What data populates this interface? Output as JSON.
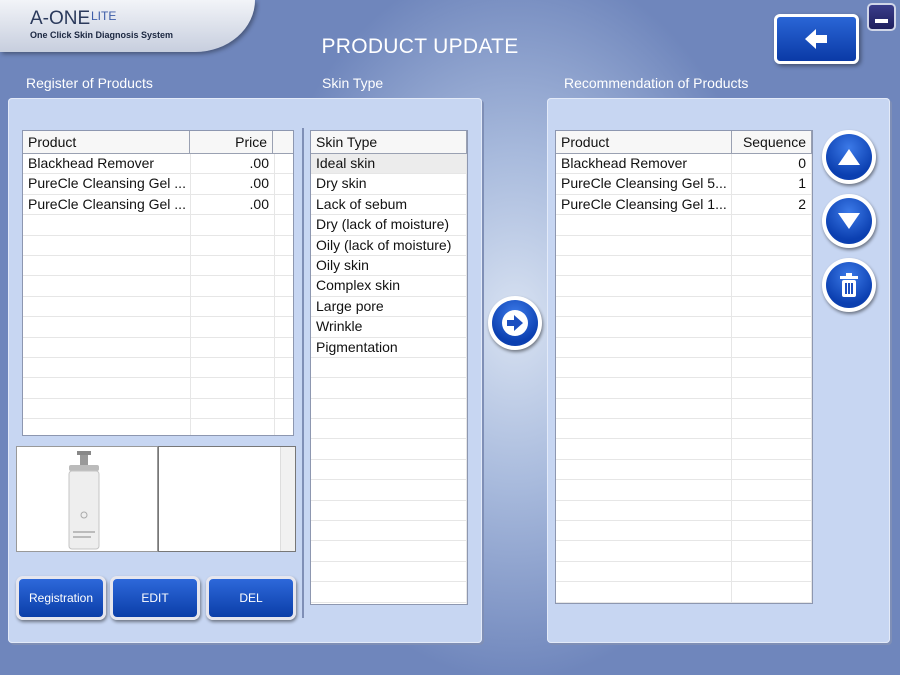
{
  "app": {
    "name": "A-ONE",
    "edition": "LITE",
    "tagline": "One Click Skin Diagnosis System"
  },
  "page_title": "PRODUCT UPDATE",
  "sections": {
    "register": "Register of Products",
    "skin_type": "Skin Type",
    "recommendation": "Recommendation of Products"
  },
  "register_table": {
    "columns": [
      "Product",
      "Price"
    ],
    "rows": [
      [
        "Blackhead Remover",
        ".00"
      ],
      [
        "PureCle Cleansing Gel ...",
        ".00"
      ],
      [
        "PureCle Cleansing Gel ...",
        ".00"
      ]
    ]
  },
  "skin_table": {
    "column": "Skin Type",
    "selected_index": 0,
    "rows": [
      "Ideal skin",
      "Dry skin",
      "Lack of sebum",
      "Dry (lack of moisture)",
      "Oily (lack of moisture)",
      "Oily skin",
      "Complex skin",
      "Large pore",
      "Wrinkle",
      "Pigmentation"
    ]
  },
  "recommend_table": {
    "columns": [
      "Product",
      "Sequence"
    ],
    "rows": [
      [
        "Blackhead Remover",
        "0"
      ],
      [
        "PureCle Cleansing Gel 5...",
        "1"
      ],
      [
        "PureCle Cleansing Gel 1...",
        "2"
      ]
    ]
  },
  "buttons": {
    "registration": "Registration",
    "edit": "EDIT",
    "del": "DEL"
  },
  "icons": [
    "back-arrow-icon",
    "minimize-icon",
    "arrow-right-icon",
    "arrow-up-icon",
    "arrow-down-icon",
    "trash-icon"
  ],
  "colors": {
    "accent": "#0b3ea8",
    "panel": "#c7d6f2",
    "background": "#6f86bc"
  }
}
